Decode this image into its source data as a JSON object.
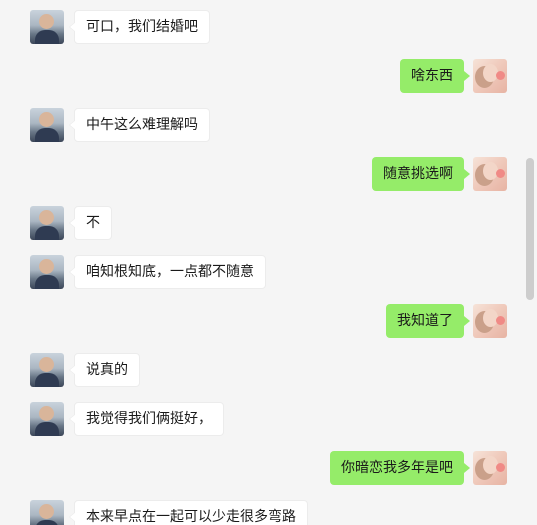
{
  "chat": {
    "messages": [
      {
        "side": "left",
        "avatar": "male",
        "text": "可口，我们结婚吧"
      },
      {
        "side": "right",
        "avatar": "female",
        "text": "啥东西"
      },
      {
        "side": "left",
        "avatar": "male",
        "text": "中午这么难理解吗"
      },
      {
        "side": "right",
        "avatar": "female",
        "text": "随意挑选啊"
      },
      {
        "side": "left",
        "avatar": "male",
        "text": "不"
      },
      {
        "side": "left",
        "avatar": "male",
        "text": "咱知根知底，一点都不随意"
      },
      {
        "side": "right",
        "avatar": "female",
        "text": "我知道了"
      },
      {
        "side": "left",
        "avatar": "male",
        "text": "说真的"
      },
      {
        "side": "left",
        "avatar": "male",
        "text": "我觉得我们俩挺好，"
      },
      {
        "side": "right",
        "avatar": "female",
        "text": "你暗恋我多年是吧"
      },
      {
        "side": "left",
        "avatar": "male",
        "text": "本来早点在一起可以少走很多弯路"
      }
    ]
  },
  "colors": {
    "background": "#f5f5f5",
    "incoming_bubble": "#ffffff",
    "outgoing_bubble": "#95ec69",
    "scrollbar_thumb": "#cdcdcd"
  }
}
